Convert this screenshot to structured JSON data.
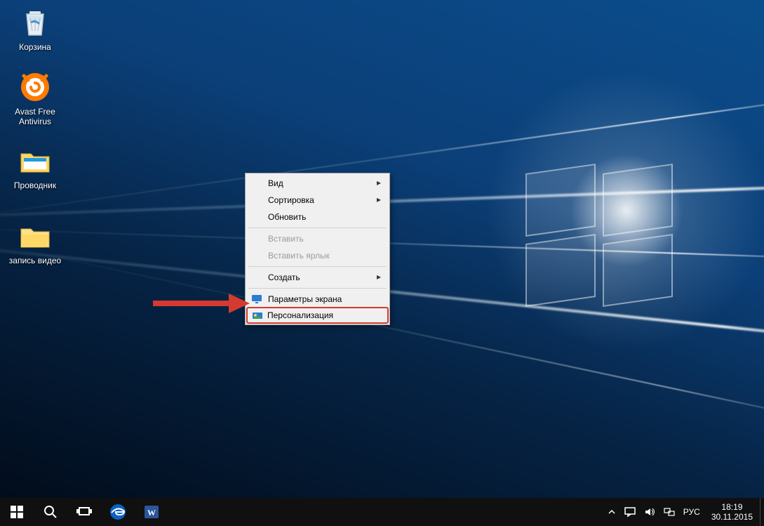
{
  "desktop_icons": [
    {
      "id": "recycle-bin",
      "label": "Корзина"
    },
    {
      "id": "avast",
      "label": "Avast Free Antivirus"
    },
    {
      "id": "explorer",
      "label": "Проводник"
    },
    {
      "id": "record-video",
      "label": "запись видео"
    }
  ],
  "context_menu": {
    "view": "Вид",
    "sort": "Сортировка",
    "refresh": "Обновить",
    "paste": "Вставить",
    "paste_shortcut": "Вставить ярлык",
    "create": "Создать",
    "display_settings": "Параметры экрана",
    "personalize": "Персонализация"
  },
  "taskbar": {
    "start": "Start",
    "search": "Search",
    "taskview": "Task View",
    "apps": [
      {
        "id": "edge",
        "name": "Microsoft Edge"
      },
      {
        "id": "word",
        "name": "Microsoft Word"
      }
    ]
  },
  "tray": {
    "language": "РУС",
    "time": "18:19",
    "date": "30.11.2015"
  }
}
